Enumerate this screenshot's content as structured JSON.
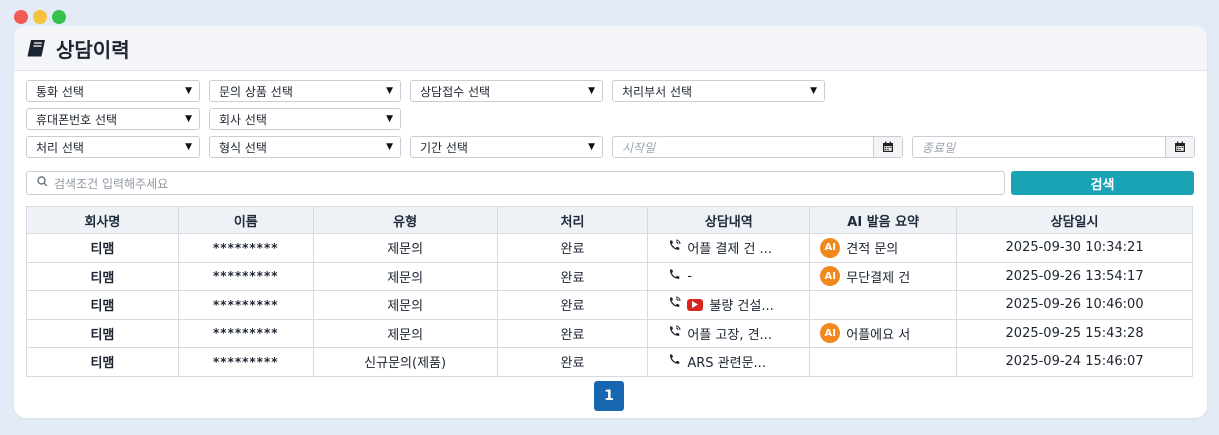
{
  "window": {
    "title": "상담이력"
  },
  "filters": {
    "call": "통화 선택",
    "product": "문의 상품 선택",
    "reception": "상담접수 선택",
    "department": "처리부서 선택",
    "mobile": "휴대폰번호 선택",
    "company": "회사 선택",
    "process": "처리 선택",
    "format": "형식 선택",
    "period": "기간 선택",
    "start_date": "시작일",
    "end_date": "종료일"
  },
  "search": {
    "placeholder": "검색조건 입력해주세요",
    "button": "검색"
  },
  "table": {
    "headers": [
      "회사명",
      "이름",
      "유형",
      "처리",
      "상담내역",
      "AI 발음 요약",
      "상담일시"
    ],
    "rows": [
      {
        "company": "티맴",
        "name": "*********",
        "type": "제문의",
        "status": "완료",
        "content": "어플 결제 건 ...",
        "content_icon": "phone-incoming-icon",
        "ai": "견적 문의",
        "datetime": "2025-09-30 10:34:21"
      },
      {
        "company": "티맴",
        "name": "*********",
        "type": "제문의",
        "status": "완료",
        "content": "-",
        "content_icon": "phone-icon",
        "ai": "무단결제 건",
        "datetime": "2025-09-26 13:54:17"
      },
      {
        "company": "티맴",
        "name": "*********",
        "type": "제문의",
        "status": "완료",
        "content": "불량 건설...",
        "content_icon": "phone-incoming-icon",
        "ai": "",
        "datetime": "2025-09-26 10:46:00"
      },
      {
        "company": "티맴",
        "name": "*********",
        "type": "제문의",
        "status": "완료",
        "content": "어플 고장, 견...",
        "content_icon": "phone-incoming-icon",
        "ai": "어플에요 서",
        "datetime": "2025-09-25 15:43:28"
      },
      {
        "company": "티맴",
        "name": "*********",
        "type": "신규문의(제품)",
        "status": "완료",
        "content": "ARS 관련문...",
        "content_icon": "phone-icon",
        "ai": "",
        "datetime": "2025-09-24 15:46:07"
      }
    ]
  },
  "ai_badge_label": "AI",
  "pagination": {
    "current": "1"
  },
  "colors": {
    "accent": "#1aa3b5",
    "page_active": "#1666b0",
    "ai_badge": "#f08a1e"
  }
}
